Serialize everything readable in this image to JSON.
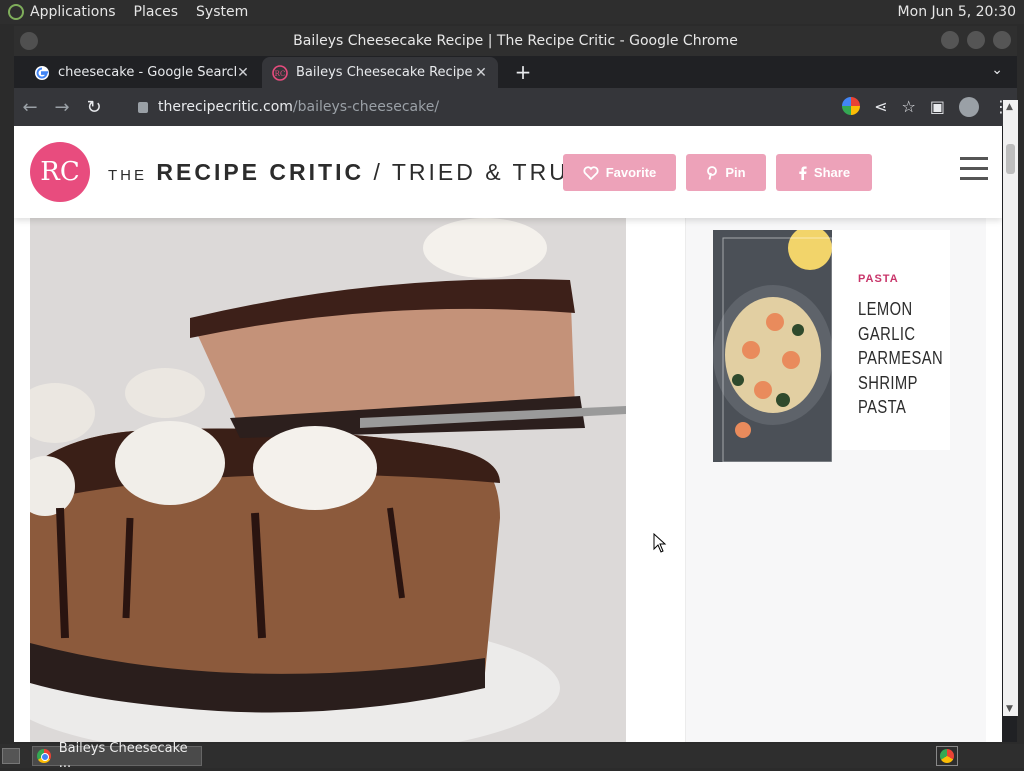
{
  "system_panel": {
    "menus": [
      "Applications",
      "Places",
      "System"
    ],
    "clock": "Mon Jun  5, 20:30"
  },
  "window": {
    "title": "Baileys Cheesecake Recipe | The Recipe Critic - Google Chrome"
  },
  "tabs": [
    {
      "label": "cheesecake - Google Search",
      "icon": "google-g-icon",
      "active": false
    },
    {
      "label": "Baileys Cheesecake Recipe | Th",
      "icon": "recipe-critic-icon",
      "active": true
    }
  ],
  "address_bar": {
    "host": "therecipecritic.com",
    "path": "/baileys-cheesecake/"
  },
  "site_header": {
    "brand_mark": "RC",
    "brand_the": "THE",
    "brand_name": "RECIPE CRITIC",
    "brand_sep": "/",
    "brand_tagline": "TRIED & TRUE",
    "favorite_label": "Favorite",
    "pin_label": "Pin",
    "share_label": "Share"
  },
  "sidebar": {
    "card": {
      "category": "PASTA",
      "title": "LEMON GARLIC PARMESAN SHRIMP PASTA"
    }
  },
  "taskbar": {
    "task_label": "Baileys Cheesecake ..."
  },
  "colors": {
    "brand_pink": "#e84c7e",
    "button_pink": "#eda2b9",
    "category_pink": "#c8356a"
  }
}
